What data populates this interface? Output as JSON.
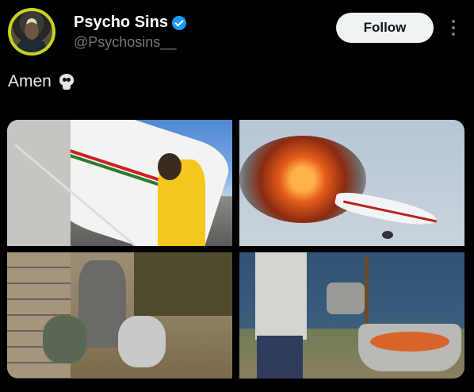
{
  "tweet": {
    "author": {
      "display_name": "Psycho Sins",
      "handle": "@Psychosins__",
      "verified": true,
      "verified_color": "#1d9bf0"
    },
    "follow_label": "Follow",
    "text": "Amen",
    "emoji": "skull",
    "media": [
      {
        "label": "man-boarding-plane-stairs"
      },
      {
        "label": "burning-airplane"
      },
      {
        "label": "man-carrying-pots"
      },
      {
        "label": "man-stirring-cooking-pot"
      }
    ]
  },
  "colors": {
    "background": "#000000",
    "text": "#e7e9ea",
    "secondary_text": "#71767b",
    "follow_button_bg": "#eff3f4"
  }
}
